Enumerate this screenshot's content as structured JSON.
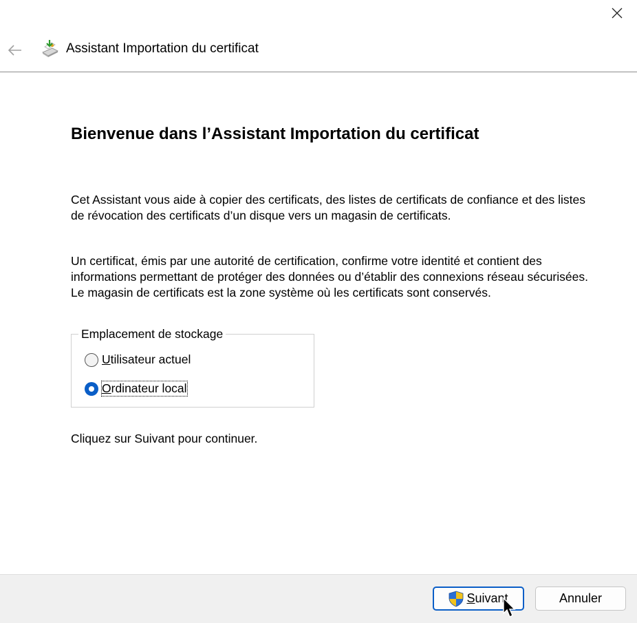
{
  "header": {
    "wizard_title": "Assistant Importation du certificat"
  },
  "main": {
    "heading": "Bienvenue dans l’Assistant Importation du certificat",
    "paragraph1": "Cet Assistant vous aide à copier des certificats, des listes de certificats de confiance et des listes de révocation des certificats d’un disque vers un magasin de certificats.",
    "paragraph2": "Un certificat, émis par une autorité de certification, confirme votre identité et contient des informations permettant de protéger des données ou d’établir des connexions réseau sécurisées. Le magasin de certificats est la zone système où les certificats sont conservés.",
    "storage_group": {
      "legend": "Emplacement de stockage",
      "options": [
        {
          "access_key": "U",
          "rest": "tilisateur actuel",
          "checked": false
        },
        {
          "access_key": "O",
          "rest": "rdinateur local",
          "checked": true
        }
      ]
    },
    "paragraph3": "Cliquez sur Suivant pour continuer."
  },
  "footer": {
    "next": {
      "access_key": "S",
      "rest": "uivant"
    },
    "cancel_label": "Annuler"
  },
  "colors": {
    "accent": "#0a5ec7",
    "footer_bg": "#f0f0f0"
  },
  "icons": {
    "close": "close-icon",
    "back": "back-arrow-icon",
    "wizard": "certificate-import-icon",
    "shield": "uac-shield-icon"
  }
}
